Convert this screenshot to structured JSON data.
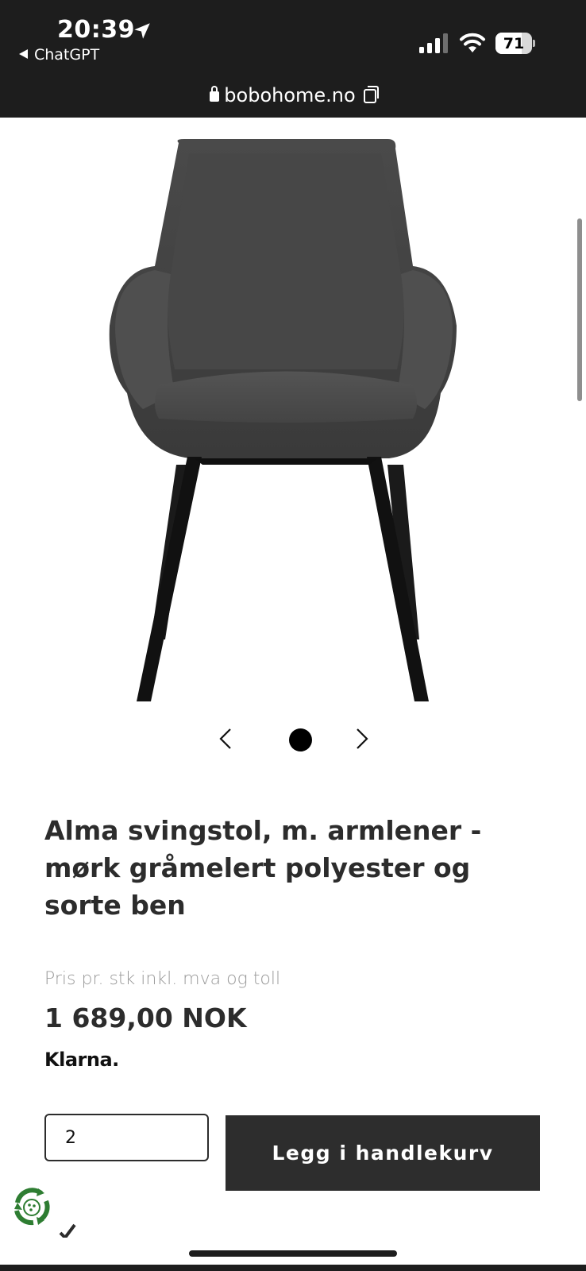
{
  "status_bar": {
    "time": "20:39",
    "back_label": "ChatGPT",
    "battery_level": 71,
    "battery_text": "71",
    "icons": [
      "location-arrow-icon",
      "cellular-signal-icon",
      "wifi-icon",
      "battery-icon"
    ]
  },
  "browser": {
    "url": "bobohome.no",
    "icons": [
      "lock-icon",
      "copy-link-icon"
    ]
  },
  "product": {
    "image_alt": "chair-product-image",
    "carousel": {
      "current_slide": 1,
      "total_slides": 1,
      "icons": [
        "chevron-left-icon",
        "chevron-right-icon"
      ]
    },
    "title": "Alma svingstol, m. armlener - mørk gråmelert polyester og sorte ben",
    "price_label": "Pris pr. stk inkl. mva og toll",
    "price": "1 689,00 NOK",
    "payment_logo_text": "Klarna."
  },
  "purchase": {
    "quantity_value": "2",
    "add_to_cart_label": "Legg i handlekurv"
  },
  "colors": {
    "chrome_background": "#1d1d1d",
    "button_background": "#2d2d2d",
    "text_dark": "#2c2c2c",
    "text_muted": "#9a9a9a",
    "eco_green": "#2e7d32"
  }
}
